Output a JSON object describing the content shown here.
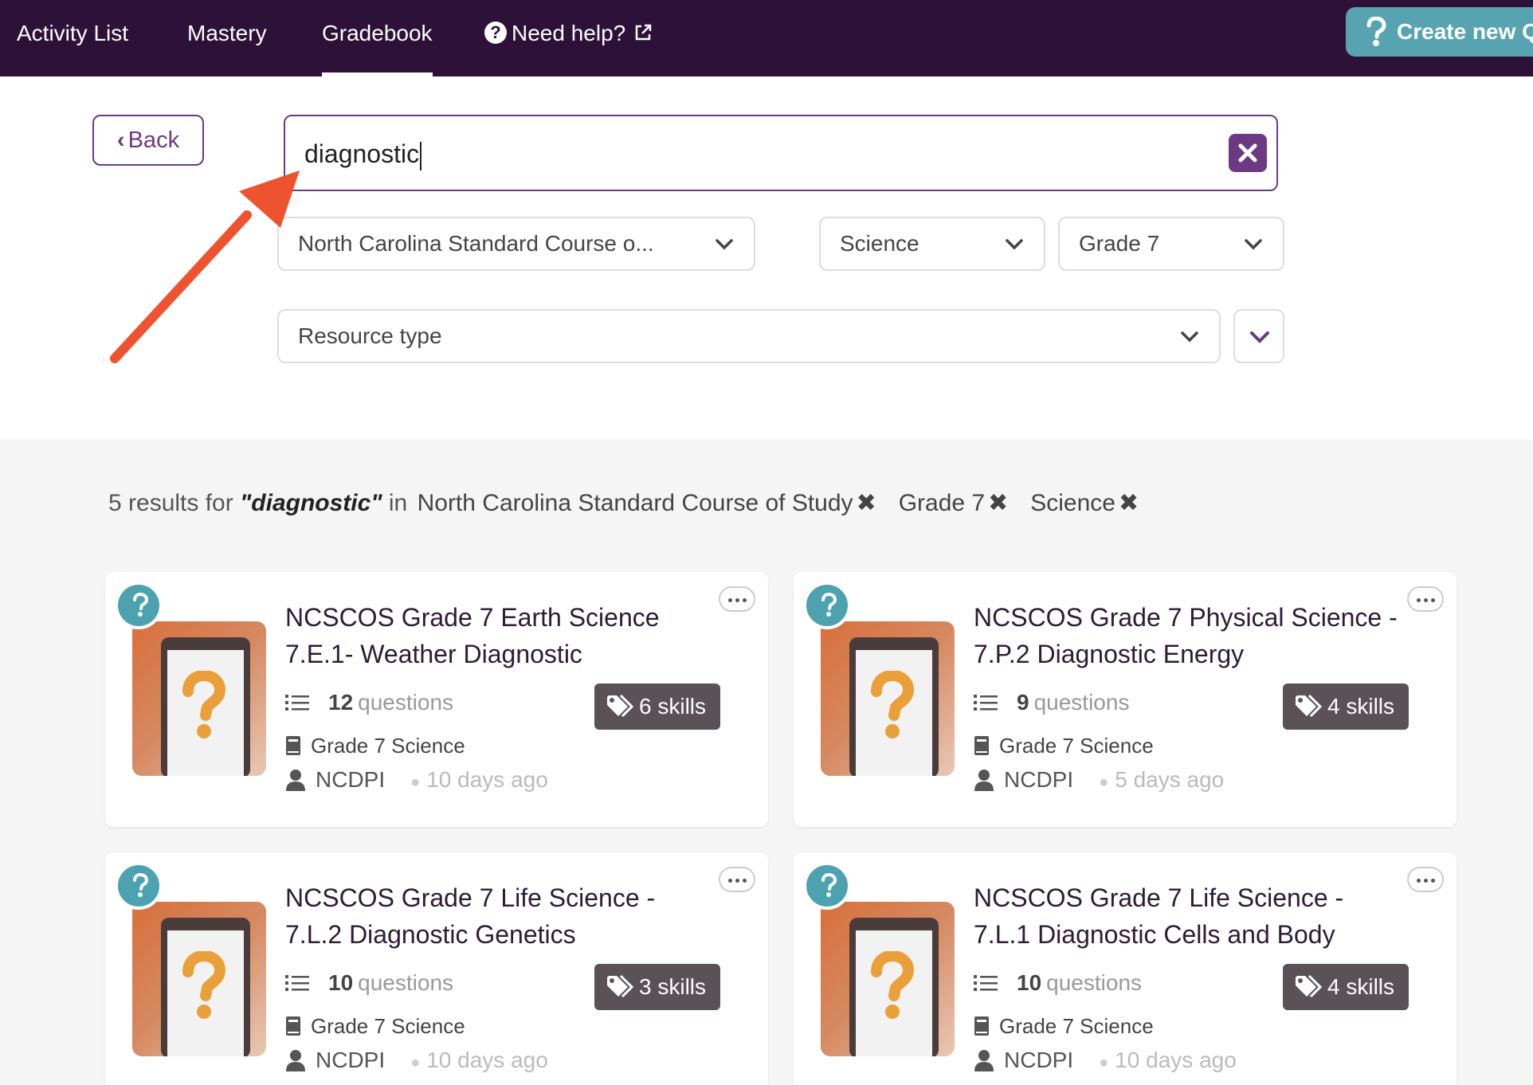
{
  "nav": {
    "items": [
      {
        "label": "Activity List"
      },
      {
        "label": "Mastery"
      },
      {
        "label": "Gradebook"
      },
      {
        "label": "Need help?"
      }
    ],
    "create_label": "Create new Q"
  },
  "search": {
    "back_label": "Back",
    "query": "diagnostic",
    "standard_select": "North Carolina Standard Course o...",
    "subject_select": "Science",
    "grade_select": "Grade 7",
    "resource_select": "Resource type"
  },
  "results": {
    "count_text": "5 results for",
    "query_text": "\"diagnostic\"",
    "in_text": "in",
    "filters": [
      "North Carolina Standard Course of Study",
      "Grade 7",
      "Science"
    ]
  },
  "cards": [
    {
      "title": "NCSCOS Grade 7 Earth Science 7.E.1- Weather Diagnostic",
      "questions_count": "12",
      "questions_label": "questions",
      "skills": "6 skills",
      "course": "Grade 7 Science",
      "author": "NCDPI",
      "time": "10 days ago"
    },
    {
      "title": "NCSCOS Grade 7 Physical Science - 7.P.2 Diagnostic Energy",
      "questions_count": "9",
      "questions_label": "questions",
      "skills": "4 skills",
      "course": "Grade 7 Science",
      "author": "NCDPI",
      "time": "5 days ago"
    },
    {
      "title": "NCSCOS Grade 7 Life Science - 7.L.2 Diagnostic Genetics",
      "questions_count": "10",
      "questions_label": "questions",
      "skills": "3 skills",
      "course": "Grade 7 Science",
      "author": "NCDPI",
      "time": "10 days ago"
    },
    {
      "title": "NCSCOS Grade 7 Life Science - 7.L.1 Diagnostic Cells and Body",
      "questions_count": "10",
      "questions_label": "questions",
      "skills": "4 skills",
      "course": "Grade 7 Science",
      "author": "NCDPI",
      "time": "10 days ago"
    }
  ],
  "colors": {
    "nav_bg": "#2e1139",
    "accent_purple": "#6b3a82",
    "teal": "#57a3b1",
    "skills_bg": "#5a5257",
    "annotation_arrow": "#ee5330"
  },
  "icons": {
    "help": "question-circle-icon",
    "external": "external-link-icon",
    "create": "quizizz-question-icon",
    "clear": "close-icon",
    "caret": "chevron-down-icon",
    "questions": "list-icon",
    "skills": "tags-icon",
    "course": "book-icon",
    "author": "user-icon",
    "more": "ellipsis-icon"
  }
}
